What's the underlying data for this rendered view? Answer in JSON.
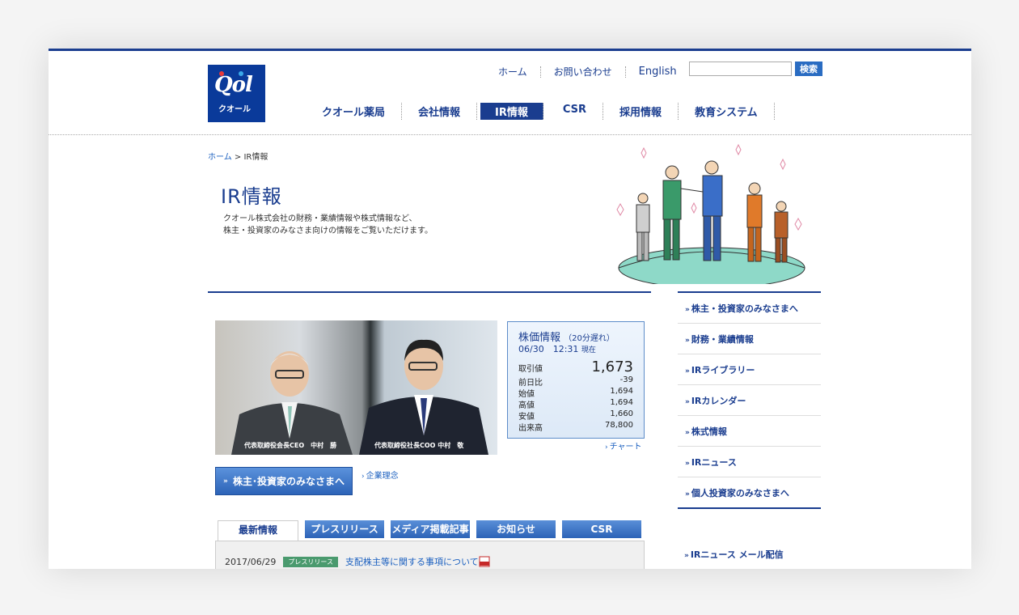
{
  "logo": {
    "mark": "Qol",
    "name": "クオール"
  },
  "toplinks": [
    "ホーム",
    "お問い合わせ",
    "English"
  ],
  "search": {
    "placeholder": "",
    "button": "検索"
  },
  "nav": [
    "クオール薬局",
    "会社情報",
    "IR情報",
    "CSR",
    "採用情報",
    "教育システム"
  ],
  "breadcrumb": {
    "home": "ホーム",
    "sep": ">",
    "current": "IR情報"
  },
  "page": {
    "title": "IR情報",
    "desc1": "クオール株式会社の財務・業績情報や株式情報など、",
    "desc2": "株主・投資家のみなさま向けの情報をご覧いただけます。"
  },
  "photo": {
    "caption_left": "代表取締役会長CEO　中村　勝",
    "caption_right": "代表取締役社長COO 中村　敬"
  },
  "stock": {
    "title": "株価情報",
    "delay": "（20分遅れ）",
    "time": "06/30　12:31",
    "time_suffix": "現在",
    "rows": [
      {
        "label": "取引値",
        "value": "1,673"
      },
      {
        "label": "前日比",
        "value": "-39"
      },
      {
        "label": "始値",
        "value": "1,694"
      },
      {
        "label": "高値",
        "value": "1,694"
      },
      {
        "label": "安値",
        "value": "1,660"
      },
      {
        "label": "出来高",
        "value": "78,800"
      }
    ],
    "chart_link": "チャート"
  },
  "investor_button": "株主･投資家のみなさまへ",
  "philosophy_link": "企業理念",
  "tabs": [
    "最新情報",
    "プレスリリース",
    "メディア掲載記事",
    "お知らせ",
    "CSR"
  ],
  "news": [
    {
      "date": "2017/06/29",
      "badge": "プレスリリース",
      "text": "支配株主等に関する事項について"
    }
  ],
  "sidebar": [
    "株主・投資家のみなさまへ",
    "財務・業績情報",
    "IRライブラリー",
    "IRカレンダー",
    "株式情報",
    "IRニュース",
    "個人投資家のみなさまへ"
  ],
  "mail_link": "IRニュース メール配信",
  "colors": {
    "brand": "#1a3d8f",
    "link": "#1a5fbf",
    "badge": "#4a9a6e"
  }
}
